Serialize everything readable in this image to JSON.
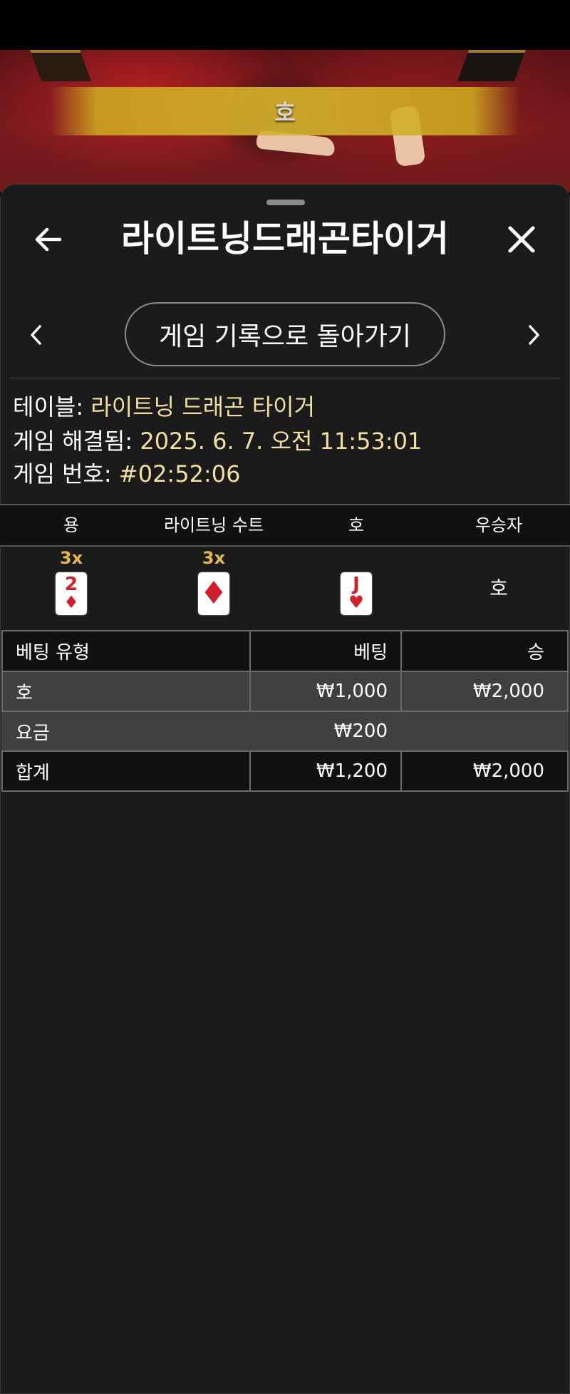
{
  "video": {
    "result_banner": "호"
  },
  "header": {
    "title": "라이트닝드래곤타이거",
    "back_icon": "arrow-left-icon",
    "close_icon": "close-icon"
  },
  "nav": {
    "back_to_history": "게임 기록으로 돌아가기",
    "prev_icon": "chevron-left-icon",
    "next_icon": "chevron-right-icon"
  },
  "info": {
    "table_label": "테이블: ",
    "table_value": "라이트닝 드래곤 타이거",
    "resolved_label": "게임 해결됨: ",
    "resolved_value": "2025. 6. 7. 오전 11:53:01",
    "game_no_label": "게임 번호: ",
    "game_no_value": "#02:52:06"
  },
  "cards": {
    "headers": [
      "용",
      "라이트닝 수트",
      "호",
      "우승자"
    ],
    "dragon": {
      "multiplier": "3x",
      "rank": "2",
      "suit": "♦"
    },
    "lightning_suit": {
      "multiplier": "3x",
      "suit": "♦"
    },
    "tiger": {
      "rank": "J",
      "suit": "♥"
    },
    "winner": "호"
  },
  "bets": {
    "headers": {
      "type": "베팅 유형",
      "bet": "베팅",
      "win": "승"
    },
    "rows": [
      {
        "type": "호",
        "bet": "₩1,000",
        "win": "₩2,000"
      },
      {
        "type": "요금",
        "bet": "₩200",
        "win": ""
      }
    ],
    "total": {
      "type": "합계",
      "bet": "₩1,200",
      "win": "₩2,000"
    }
  }
}
